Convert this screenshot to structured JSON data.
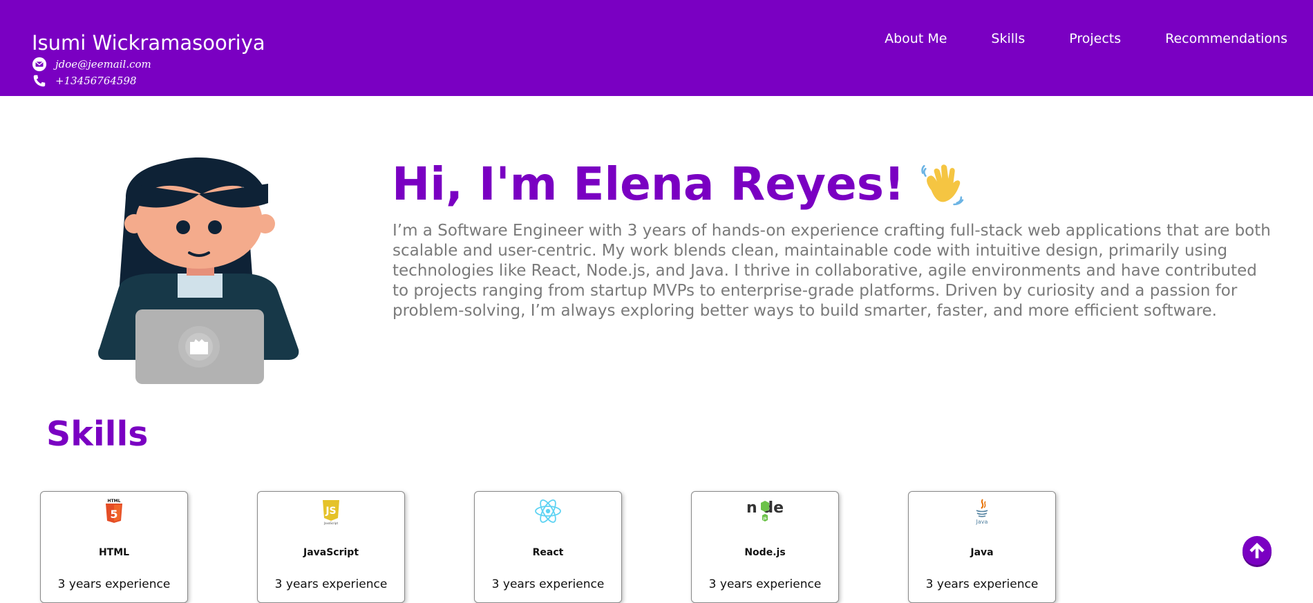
{
  "header": {
    "name": "Isumi Wickramasooriya",
    "email": "jdoe@jeemail.com",
    "phone": "+13456764598",
    "nav": [
      "About Me",
      "Skills",
      "Projects",
      "Recommendations"
    ]
  },
  "hero": {
    "title": "Hi, I'm Elena Reyes!",
    "bio": "I’m a Software Engineer with 3 years of hands-on experience crafting full-stack web applications that are both scalable and user-centric. My work blends clean, maintainable code with intuitive design, primarily using technologies like React, Node.js, and Java. I thrive in collaborative, agile environments and have contributed to projects ranging from startup MVPs to enterprise-grade platforms. Driven by curiosity and a passion for problem-solving, I’m always exploring better ways to build smarter, faster, and more efficient software."
  },
  "skills": {
    "title": "Skills",
    "items": [
      {
        "name": "HTML",
        "experience": "3 years experience",
        "icon": "html5-icon"
      },
      {
        "name": "JavaScript",
        "experience": "3 years experience",
        "icon": "javascript-icon"
      },
      {
        "name": "React",
        "experience": "3 years experience",
        "icon": "react-icon"
      },
      {
        "name": "Node.js",
        "experience": "3 years experience",
        "icon": "nodejs-icon"
      },
      {
        "name": "Java",
        "experience": "3 years experience",
        "icon": "java-icon"
      }
    ]
  },
  "colors": {
    "accent": "#7a00c2",
    "body_text": "#7a7a7a"
  }
}
